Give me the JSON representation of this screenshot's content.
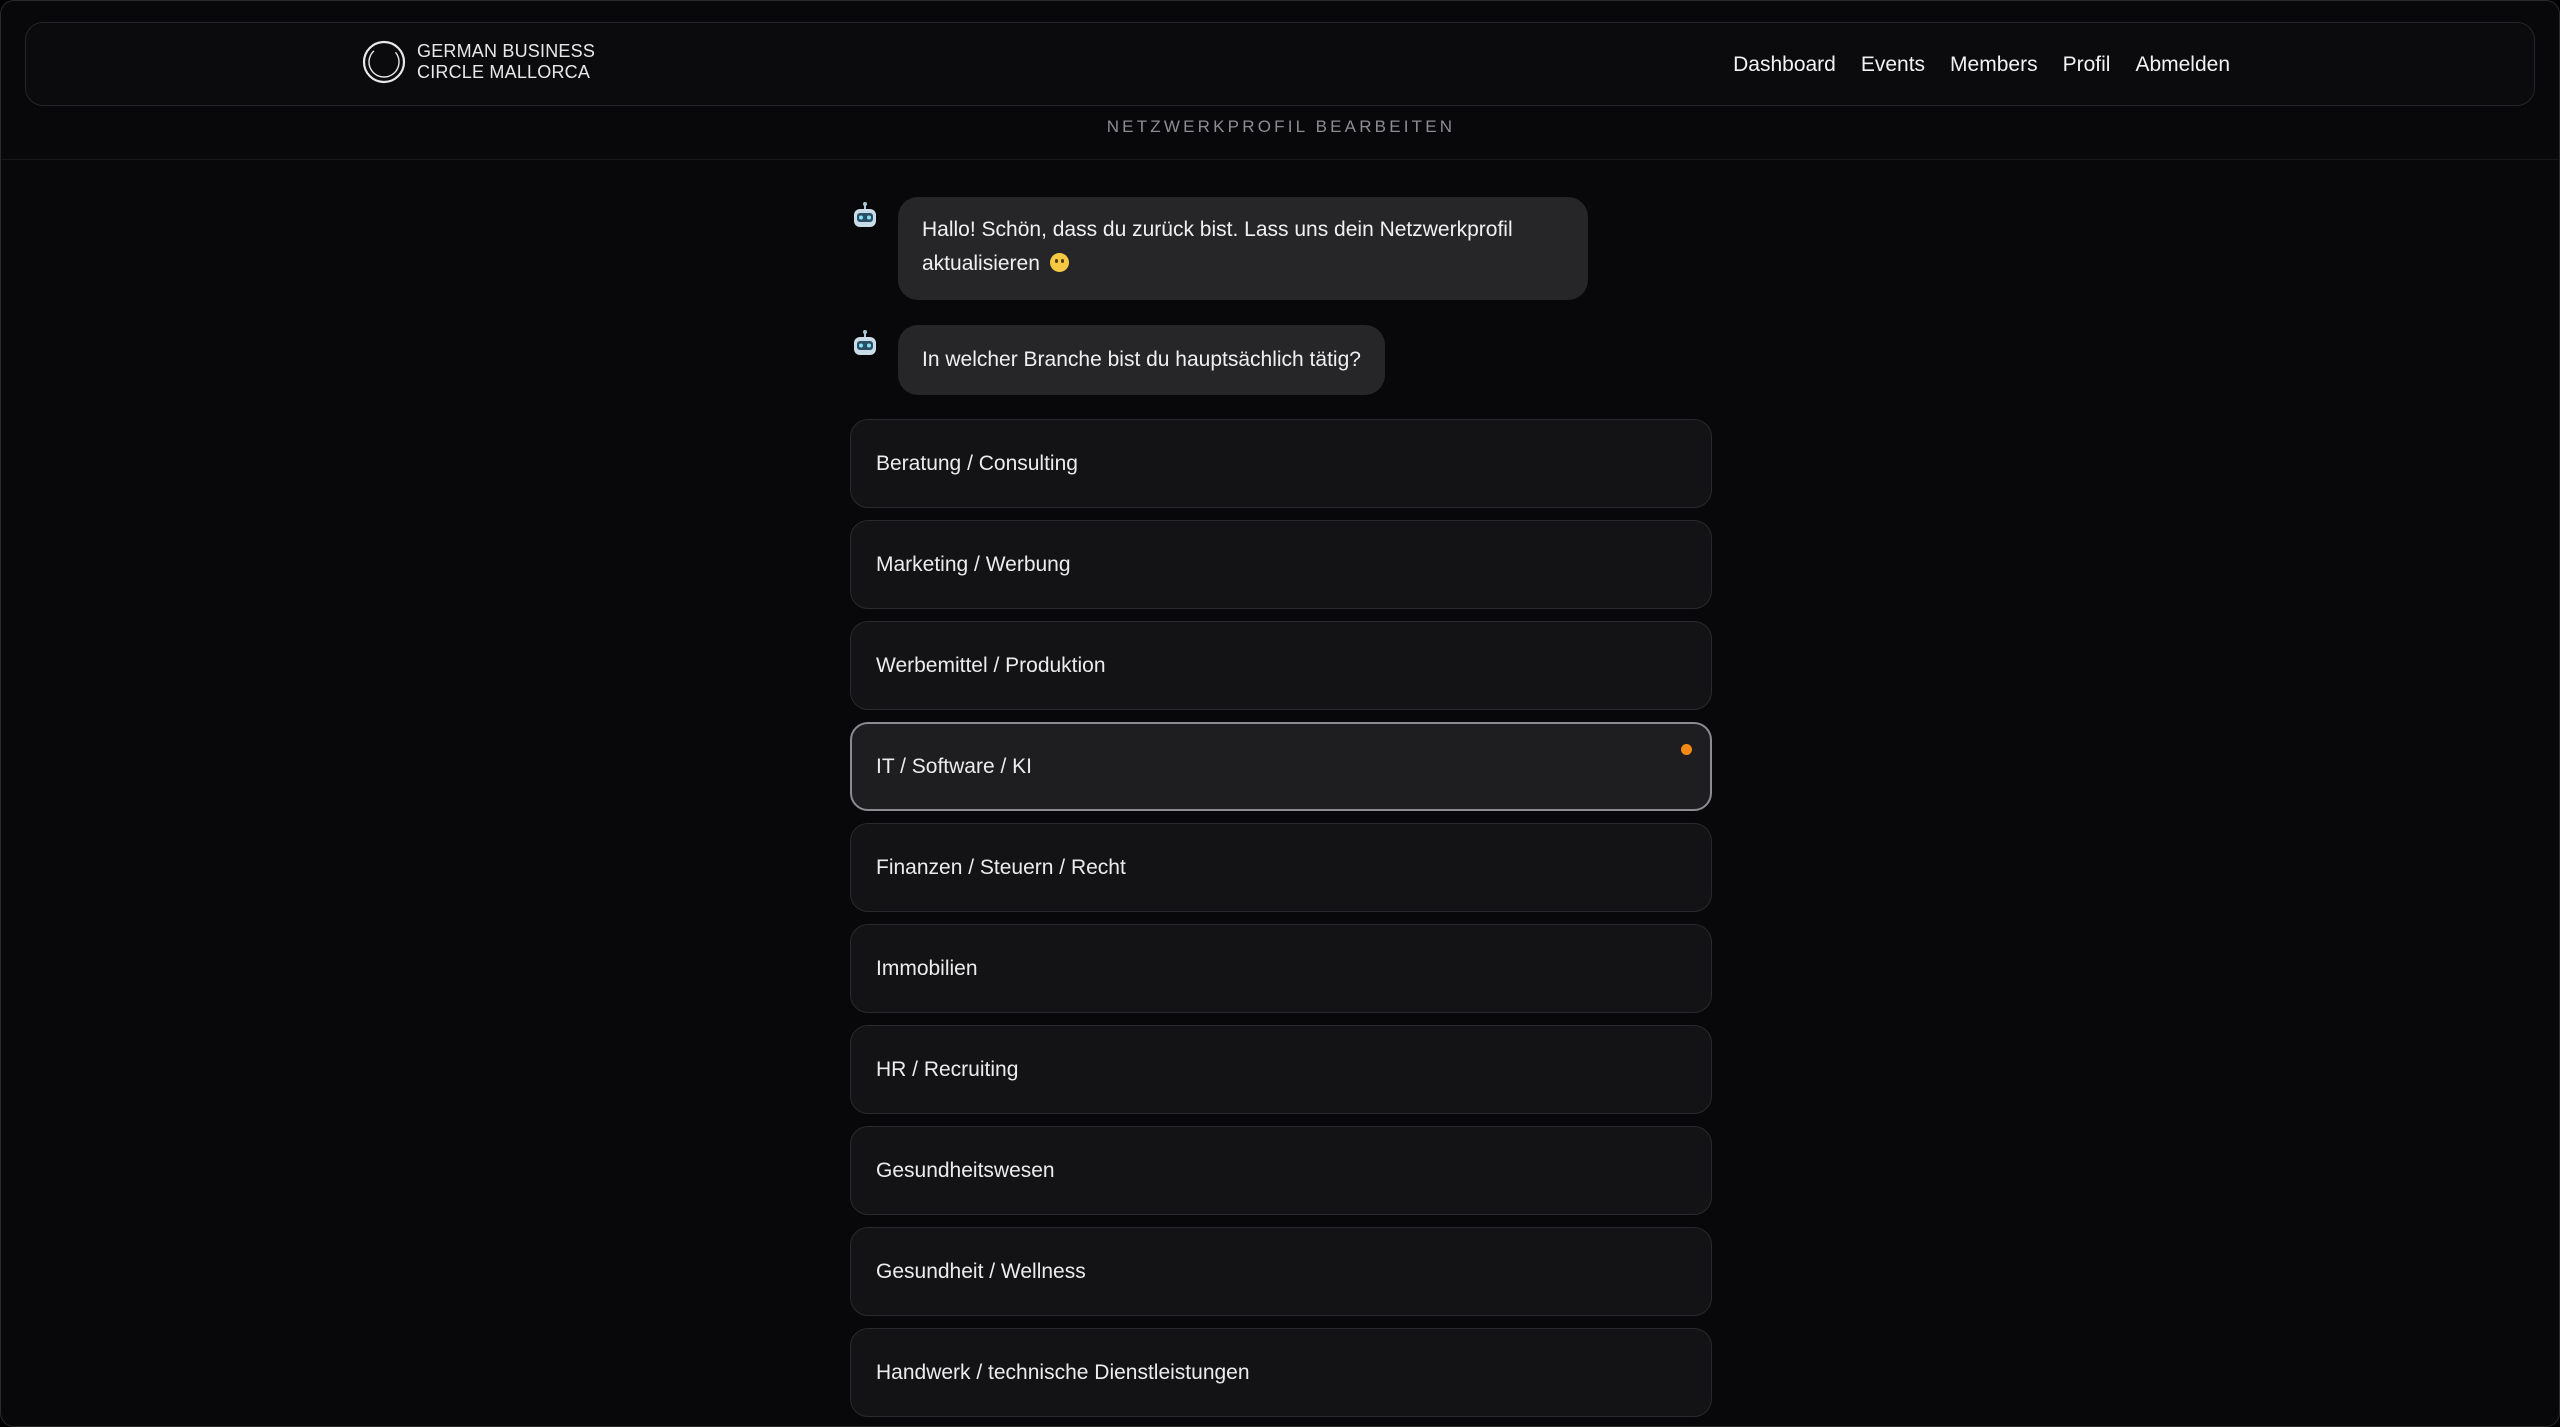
{
  "header": {
    "logo_line1": "GERMAN BUSINESS",
    "logo_line2": "CIRCLE MALLORCA",
    "logo_icon": "circle-ring-logo",
    "nav": [
      {
        "label": "Dashboard"
      },
      {
        "label": "Events"
      },
      {
        "label": "Members"
      },
      {
        "label": "Profil"
      },
      {
        "label": "Abmelden"
      }
    ]
  },
  "page": {
    "title": "NETZWERKPROFIL BEARBEITEN"
  },
  "chat": {
    "bot_icon": "robot-icon",
    "messages": [
      {
        "text": "Hallo! Schön, dass du zurück bist. Lass uns dein Netzwerkprofil aktualisieren",
        "emoji": "smiling-face-emoji"
      },
      {
        "text": "In welcher Branche bist du hauptsächlich tätig?"
      }
    ]
  },
  "options": {
    "selected": "IT / Software / KI",
    "accent_color": "#f38a16",
    "items": [
      {
        "label": "Beratung / Consulting"
      },
      {
        "label": "Marketing / Werbung"
      },
      {
        "label": "Werbemittel / Produktion"
      },
      {
        "label": "IT / Software / KI"
      },
      {
        "label": "Finanzen / Steuern / Recht"
      },
      {
        "label": "Immobilien"
      },
      {
        "label": "HR / Recruiting"
      },
      {
        "label": "Gesundheitswesen"
      },
      {
        "label": "Gesundheit / Wellness"
      },
      {
        "label": "Handwerk / technische Dienstleistungen"
      }
    ]
  }
}
